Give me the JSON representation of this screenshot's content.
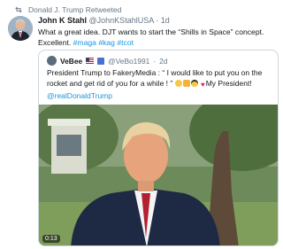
{
  "retweet": {
    "label": "Donald J. Trump Retweeted",
    "icon": "retweet-icon"
  },
  "tweet": {
    "display_name": "John K Stahl",
    "handle": "@JohnKStahlUSA",
    "separator": "·",
    "age": "1d",
    "text": "What a great idea. DJT wants to start the “Shills in Space” concept. Excellent.",
    "hashtags": [
      "#maga",
      "#kag",
      "#tcot"
    ]
  },
  "quote": {
    "display_name": "VeBee",
    "handle": "@VeBo1991",
    "separator": "·",
    "age": "2d",
    "text_start": "President Trump to FakeryMedia : “ I would like to put you on the rocket and get rid of you for a while ! ”",
    "text_end": "My President!",
    "mention": "@realDonaldTrump",
    "video": {
      "timestamp": "0:13"
    }
  },
  "colors": {
    "link": "#1b95e0",
    "muted": "#657786",
    "border": "#ccd6dd"
  }
}
